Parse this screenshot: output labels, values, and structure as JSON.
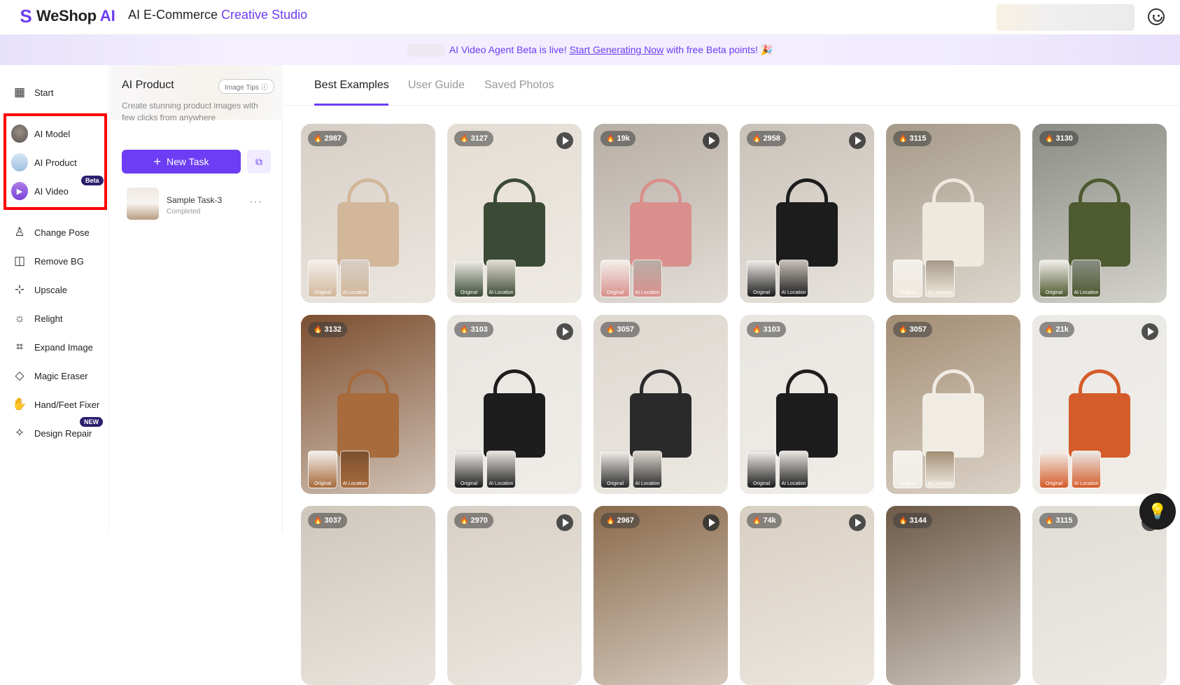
{
  "header": {
    "logo_mark": "S",
    "logo_text": "WeShop",
    "logo_ai": "AI",
    "title_plain": "AI E-Commerce ",
    "title_accent": "Creative Studio"
  },
  "banner": {
    "text_before": "AI Video Agent Beta is live! ",
    "link": "Start Generating Now",
    "text_after": " with free Beta points! 🎉"
  },
  "sidebar": {
    "items": [
      {
        "label": "Start",
        "icon": "grid-icon",
        "glyph": "▦"
      },
      {
        "label": "AI Model",
        "icon": "ai-model-avatar-icon"
      },
      {
        "label": "AI Product",
        "icon": "ai-product-icon"
      },
      {
        "label": "AI Video",
        "icon": "ai-video-icon",
        "badge": "Beta"
      },
      {
        "label": "Change Pose",
        "icon": "pose-icon",
        "glyph": "♙"
      },
      {
        "label": "Remove BG",
        "icon": "remove-bg-icon",
        "glyph": "◫"
      },
      {
        "label": "Upscale",
        "icon": "upscale-icon",
        "glyph": "⊹"
      },
      {
        "label": "Relight",
        "icon": "relight-icon",
        "glyph": "☼"
      },
      {
        "label": "Expand Image",
        "icon": "crop-icon",
        "glyph": "⌗"
      },
      {
        "label": "Magic Eraser",
        "icon": "eraser-icon",
        "glyph": "◇"
      },
      {
        "label": "Hand/Feet Fixer",
        "icon": "hand-icon",
        "glyph": "✋"
      },
      {
        "label": "Design Repair",
        "icon": "magic-wand-icon",
        "glyph": "✧",
        "badge": "NEW"
      }
    ]
  },
  "panel": {
    "title": "AI Product",
    "tips": "Image Tips ⓘ",
    "description": "Create stunning product images with few clicks from anywhere",
    "new_task": "New Task",
    "task": {
      "name": "Sample Task-3",
      "status": "Completed"
    }
  },
  "tabs": [
    "Best Examples",
    "User Guide",
    "Saved Photos"
  ],
  "thumb_labels": {
    "original": "Original",
    "ai_location": "AI Location"
  },
  "cards": [
    {
      "count": "2987",
      "video": false,
      "bg": "#d7cfc6",
      "bag": "#d2b79b"
    },
    {
      "count": "3127",
      "video": true,
      "bg": "#e4ddd4",
      "bag": "#3b4a35"
    },
    {
      "count": "19k",
      "video": true,
      "bg": "#b7aea5",
      "bag": "#d9908d"
    },
    {
      "count": "2958",
      "video": true,
      "bg": "#c9c2b9",
      "bag": "#1c1c1c"
    },
    {
      "count": "3115",
      "video": false,
      "bg": "#a69a88",
      "bag": "#efe8dc"
    },
    {
      "count": "3130",
      "video": false,
      "bg": "#8a8d84",
      "bag": "#4e5a2f"
    },
    {
      "count": "3132",
      "video": false,
      "bg": "#7c4f30",
      "bag": "#a76b3c"
    },
    {
      "count": "3103",
      "video": true,
      "bg": "#e9e6e2",
      "bag": "#1d1d1d"
    },
    {
      "count": "3057",
      "video": false,
      "bg": "#ddd7cf",
      "bag": "#2a2a2a"
    },
    {
      "count": "3103",
      "video": false,
      "bg": "#e9e6e2",
      "bag": "#1d1d1d"
    },
    {
      "count": "3057",
      "video": false,
      "bg": "#a38d73",
      "bag": "#f0ece4"
    },
    {
      "count": "21k",
      "video": true,
      "bg": "#ebe9e6",
      "bag": "#d45c2a"
    },
    {
      "count": "3037",
      "video": false,
      "bg": "#cfc7bc",
      "bag": "#cfc7bc"
    },
    {
      "count": "2970",
      "video": true,
      "bg": "#d8d0c6",
      "bag": "#d8d0c6"
    },
    {
      "count": "2967",
      "video": true,
      "bg": "#8a6a4c",
      "bag": "#8a6a4c"
    },
    {
      "count": "74k",
      "video": true,
      "bg": "#d9cfc2",
      "bag": "#d9cfc2"
    },
    {
      "count": "3144",
      "video": false,
      "bg": "#6d5a47",
      "bag": "#6d5a47"
    },
    {
      "count": "3115",
      "video": true,
      "bg": "#e0ddd7",
      "bag": "#e0ddd7"
    }
  ],
  "colors": {
    "accent": "#6c3df4",
    "highlight_box": "#ff0000"
  },
  "help_icon": "lightbulb-icon"
}
